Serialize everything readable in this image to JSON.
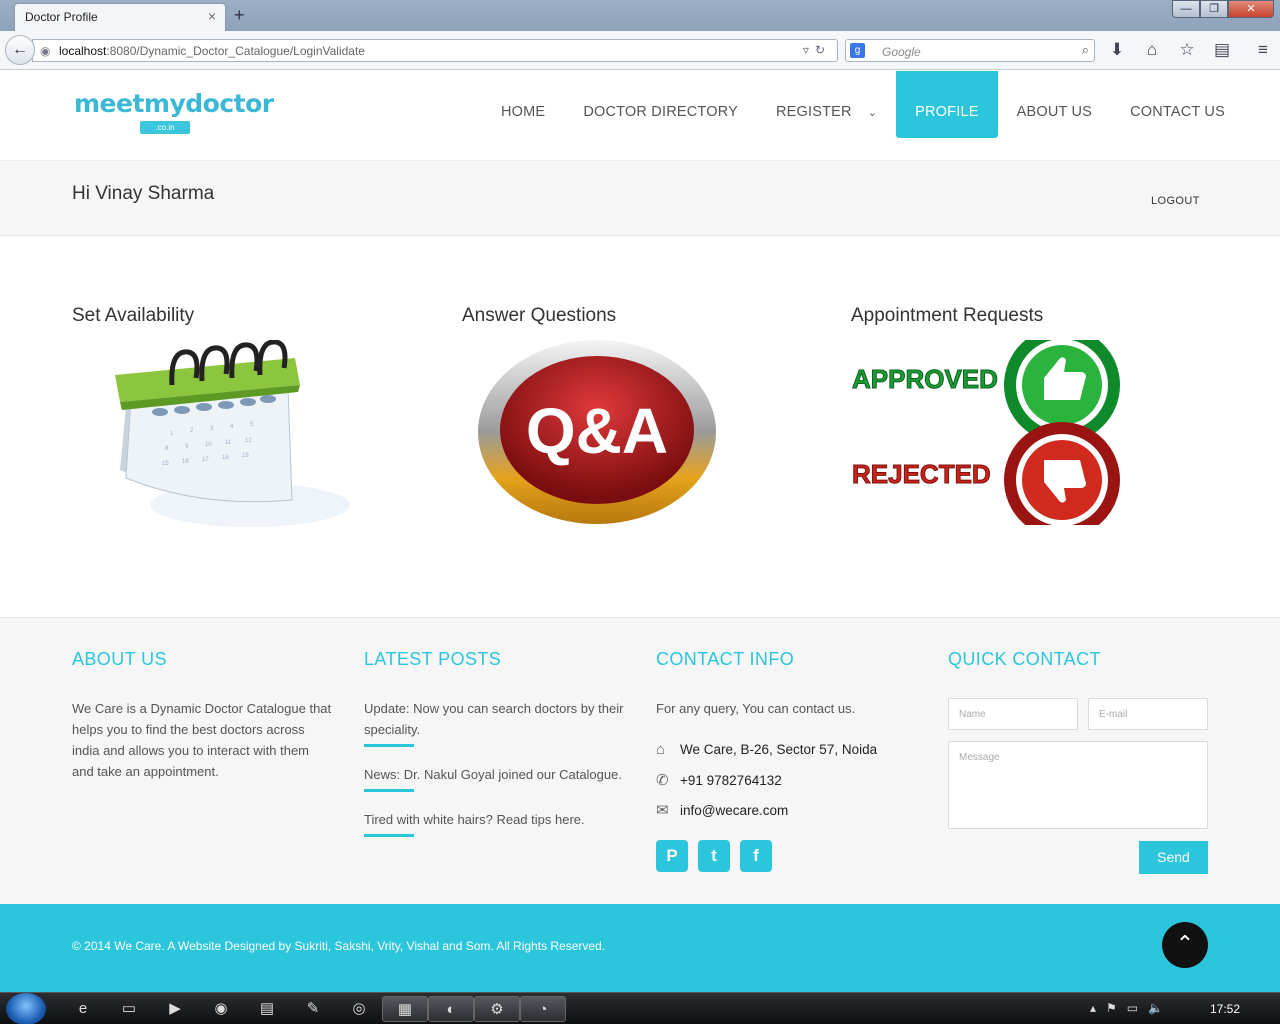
{
  "browser": {
    "tab_title": "Doctor Profile",
    "tab_close": "×",
    "new_tab": "+",
    "url_host": "localhost",
    "url_rest": ":8080/Dynamic_Doctor_Catalogue/LoginValidate",
    "search_placeholder": "Google",
    "window_buttons": [
      "—",
      "❐",
      "✕"
    ]
  },
  "site": {
    "logo": "meetmydoctor",
    "logo_sub": ".co.in",
    "menu": [
      "HOME",
      "DOCTOR DIRECTORY",
      "REGISTER",
      "PROFILE",
      "ABOUT US",
      "CONTACT US"
    ],
    "active_menu": "PROFILE",
    "greeting": "Hi Vinay Sharma",
    "logout": "LOGOUT"
  },
  "cards": {
    "availability": "Set Availability",
    "questions": "Answer Questions",
    "qa_text": "Q&A",
    "appointments": "Appointment Requests",
    "approved": "APPROVED",
    "rejected": "REJECTED"
  },
  "footer": {
    "about_title": "ABOUT US",
    "about_text": "We Care is a Dynamic Doctor Catalogue that helps you to find the best doctors across india and allows you to interact with them and take an appointment.",
    "posts_title": "LATEST POSTS",
    "posts": [
      "Update: Now you can search doctors by their speciality.",
      "News: Dr. Nakul Goyal joined our Catalogue.",
      "Tired with white hairs? Read tips here."
    ],
    "contact_title": "CONTACT INFO",
    "contact_intro": "For any query, You can contact us.",
    "address": "We Care, B-26, Sector 57, Noida",
    "phone": "+91 9782764132",
    "email": "info@wecare.com",
    "quick_title": "QUICK CONTACT",
    "name_placeholder": "Name",
    "email_placeholder": "E-mail",
    "message_placeholder": "Message",
    "send": "Send",
    "copyright": "© 2014 We Care. A Website Designed by Sukriti, Sakshi, Vrity, Vishal and Som. All Rights Reserved."
  },
  "taskbar": {
    "clock": "17:52"
  },
  "colors": {
    "accent": "#2bc6dc",
    "approved": "#19a53a",
    "rejected": "#c8241c"
  }
}
